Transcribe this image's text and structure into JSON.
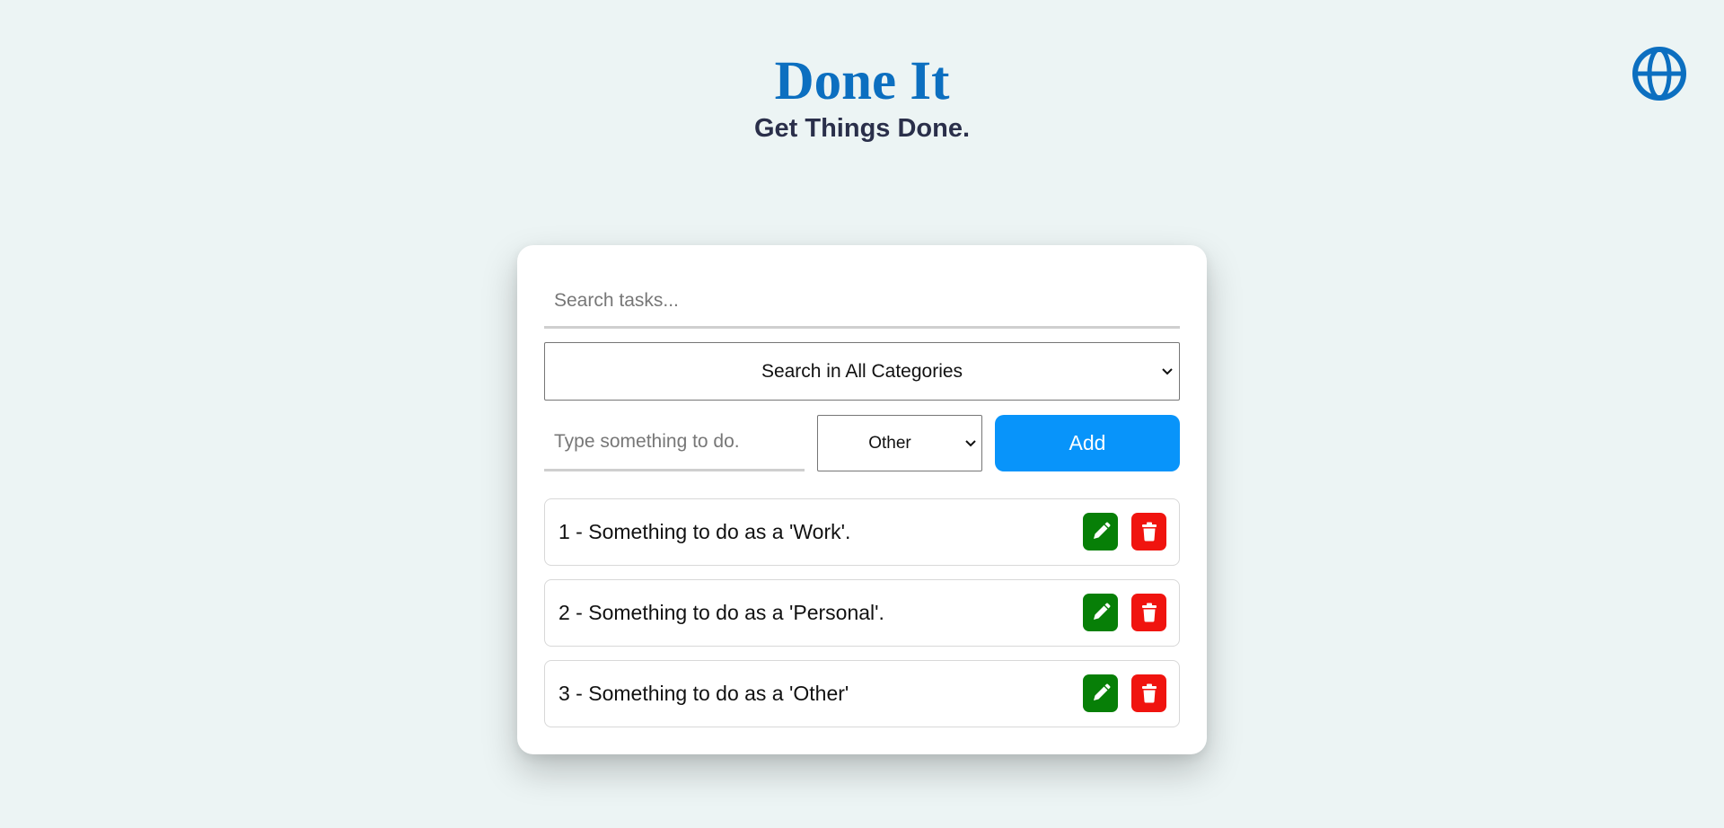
{
  "header": {
    "title": "Done It",
    "subtitle": "Get Things Done."
  },
  "language_button": {
    "icon": "globe-icon",
    "color": "#0c6fc0"
  },
  "search": {
    "value": "",
    "placeholder": "Search tasks..."
  },
  "category_filter": {
    "selected": "Search in All Categories"
  },
  "new_task": {
    "value": "",
    "placeholder": "Type something to do.",
    "category_selected": "Other",
    "add_label": "Add"
  },
  "tasks": [
    {
      "text": "1 - Something to do as a 'Work'."
    },
    {
      "text": "2 - Something to do as a 'Personal'."
    },
    {
      "text": "3 - Something to do as a 'Other'"
    }
  ],
  "colors": {
    "background": "#ecf4f4",
    "title": "#0c6fc0",
    "subtitle": "#2a2f4a",
    "add_button": "#0894fa",
    "edit_button": "#077f07",
    "delete_button": "#f0140f"
  }
}
